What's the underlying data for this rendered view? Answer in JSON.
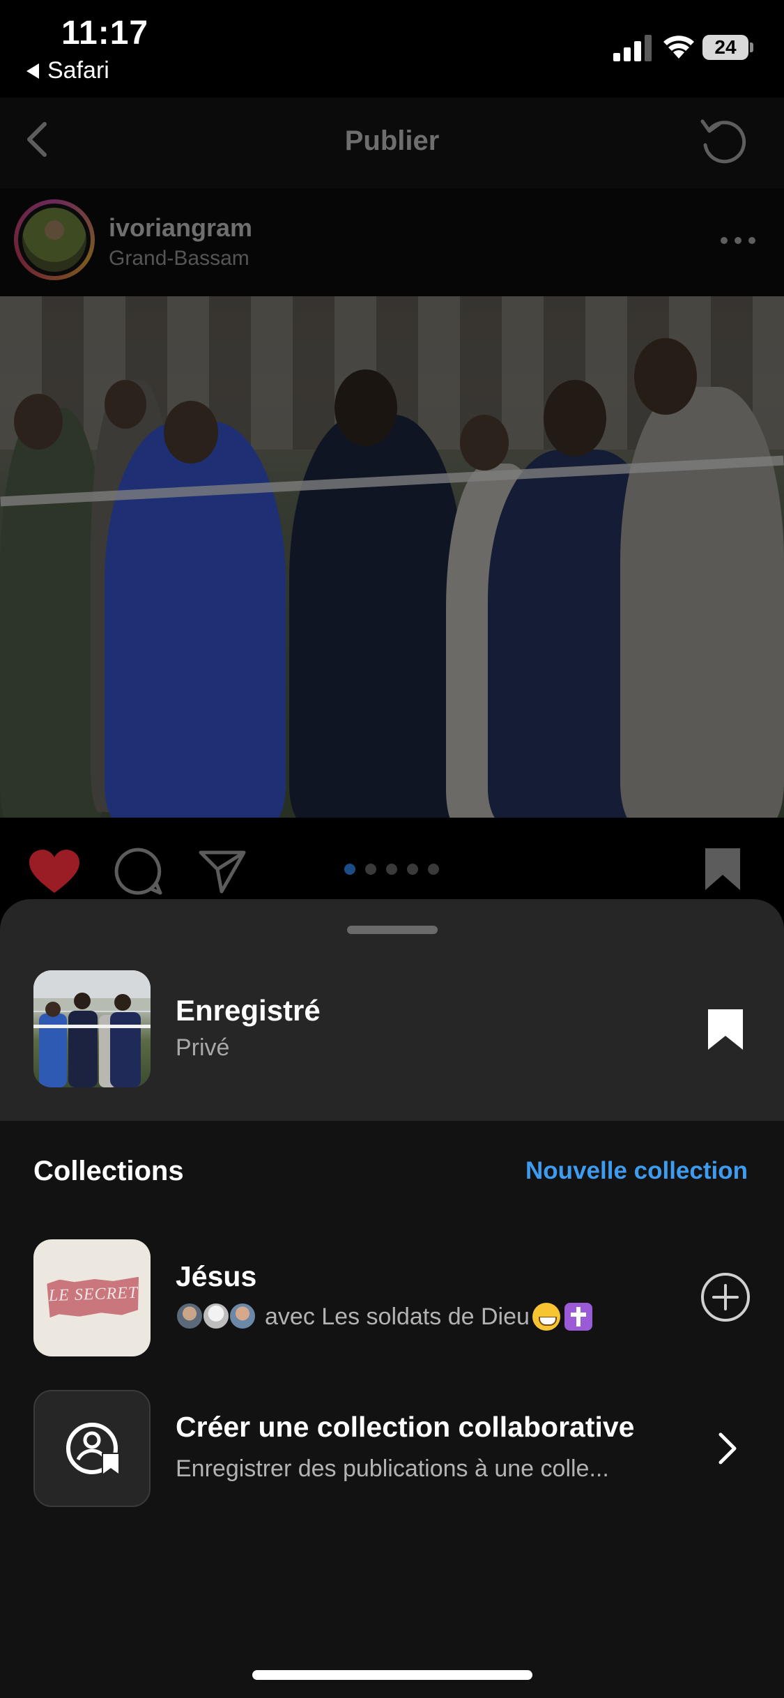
{
  "status_bar": {
    "time": "11:17",
    "back_app": "Safari",
    "battery_level": "24"
  },
  "nav": {
    "title": "Publier"
  },
  "post": {
    "username": "ivoriangram",
    "location": "Grand-Bassam",
    "liked": true,
    "carousel_active_index": 0,
    "carousel_count": 5
  },
  "sheet": {
    "saved": {
      "title": "Enregistré",
      "subtitle": "Privé"
    },
    "collections_label": "Collections",
    "new_collection_label": "Nouvelle collection",
    "collections": [
      {
        "name": "Jésus",
        "meta": "avec Les soldats de Dieu",
        "thumb_text": "LE SECRET",
        "action_icon": "add-circle-icon"
      }
    ],
    "collaborative": {
      "title": "Créer une collection collaborative",
      "subtitle": "Enregistrer des publications à une colle..."
    }
  },
  "colors": {
    "accent_link": "#3e9cf0",
    "like_red": "#c0202d",
    "sheet_top": "#262626",
    "sheet_bg": "#121212"
  }
}
